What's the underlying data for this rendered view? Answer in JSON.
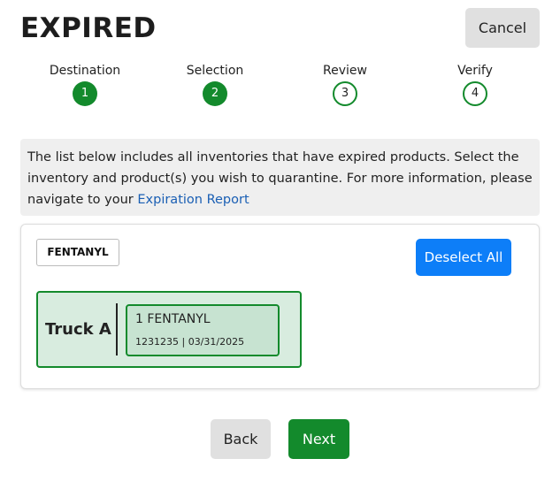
{
  "header": {
    "title": "EXPIRED",
    "cancel_label": "Cancel"
  },
  "steps": [
    {
      "label": "Destination",
      "number": "1",
      "status": "complete"
    },
    {
      "label": "Selection",
      "number": "2",
      "status": "complete"
    },
    {
      "label": "Review",
      "number": "3",
      "status": "pending"
    },
    {
      "label": "Verify",
      "number": "4",
      "status": "pending"
    }
  ],
  "info": {
    "text": "The list below includes all inventories that have expired products. Select the inventory and product(s) you wish to quarantine. For more information, please navigate to your ",
    "link_text": "Expiration Report"
  },
  "selection": {
    "filter_chip": "FENTANYL",
    "deselect_label": "Deselect All",
    "inventory": {
      "name": "Truck A",
      "product": {
        "name": "1 FENTANYL",
        "meta": "1231235 | 03/31/2025"
      }
    }
  },
  "footer": {
    "back_label": "Back",
    "next_label": "Next"
  },
  "colors": {
    "accent_green": "#138a2c",
    "primary_blue": "#0d7ef8",
    "link_blue": "#1a5fb4",
    "neutral_button": "#e0e0e0"
  }
}
